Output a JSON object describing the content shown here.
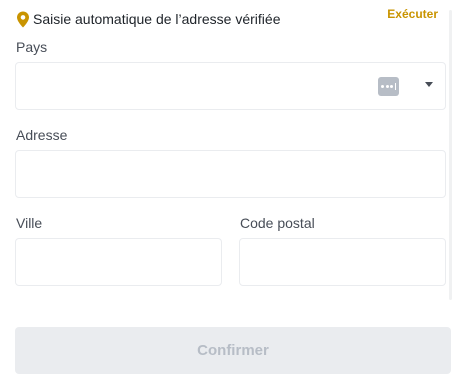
{
  "autofill": {
    "icon": "location-pin-icon",
    "text": "Saisie automatique de l’adresse vérifiée",
    "action_label": "Exécuter",
    "accent_color": "#C99400"
  },
  "form": {
    "country": {
      "label": "Pays",
      "value": "",
      "icons": [
        "password-manager-icon",
        "caret-down-icon"
      ]
    },
    "address": {
      "label": "Adresse",
      "value": ""
    },
    "city": {
      "label": "Ville",
      "value": ""
    },
    "postal_code": {
      "label": "Code postal",
      "value": ""
    }
  },
  "confirm_button": {
    "label": "Confirmer",
    "state": "disabled"
  }
}
